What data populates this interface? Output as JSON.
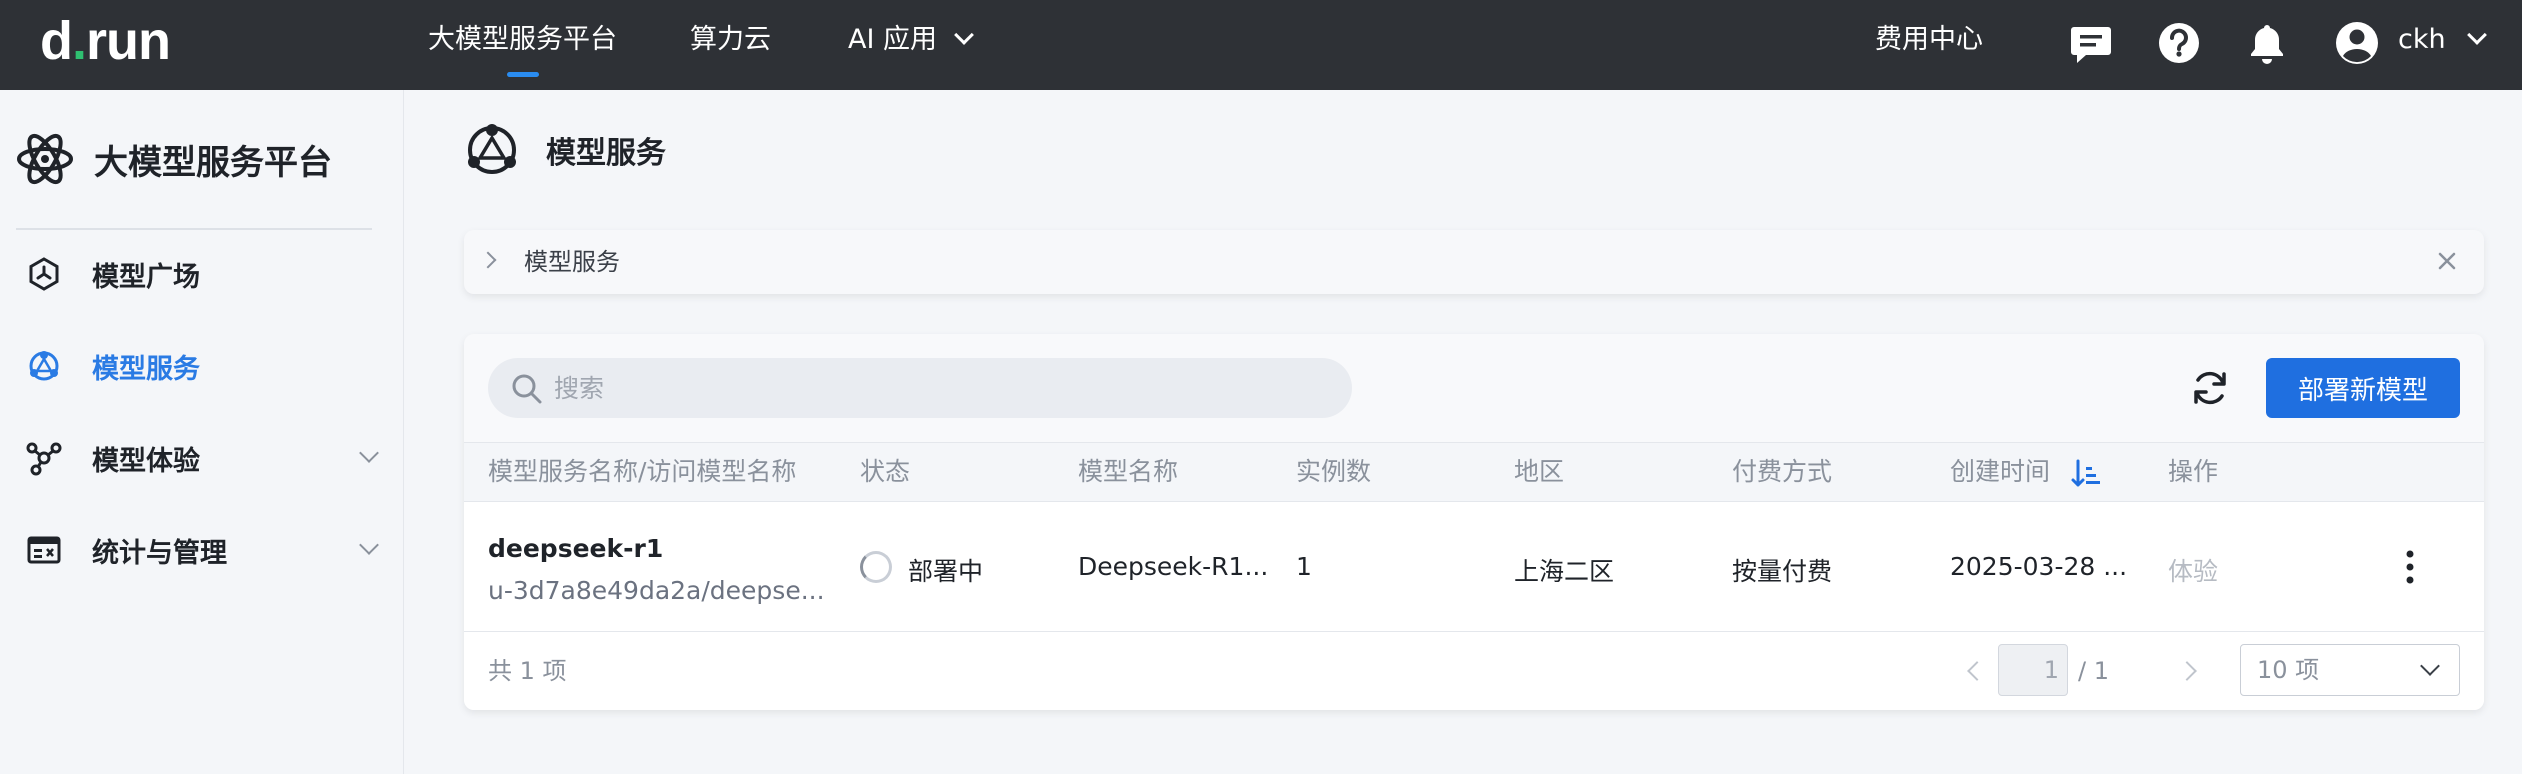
{
  "topbar": {
    "logo_prefix": "d",
    "logo_dot": ".",
    "logo_suffix": "run",
    "nav": [
      {
        "label": "大模型服务平台",
        "active": true
      },
      {
        "label": "算力云",
        "active": false
      },
      {
        "label": "AI 应用",
        "active": false
      }
    ],
    "billing": "费用中心",
    "icons": [
      "message-icon",
      "help-icon",
      "bell-icon",
      "user-avatar-icon"
    ],
    "user": "ckh"
  },
  "sidebar": {
    "title": "大模型服务平台",
    "items": [
      {
        "label": "模型广场",
        "icon": "hexagon-icon",
        "expandable": false,
        "active": false
      },
      {
        "label": "模型服务",
        "icon": "model-service-icon",
        "expandable": false,
        "active": true
      },
      {
        "label": "模型体验",
        "icon": "experience-icon",
        "expandable": true,
        "active": false
      },
      {
        "label": "统计与管理",
        "icon": "stats-icon",
        "expandable": true,
        "active": false
      }
    ]
  },
  "page": {
    "title": "模型服务",
    "breadcrumb": "模型服务"
  },
  "toolbar": {
    "search_placeholder": "搜索",
    "deploy_button": "部署新模型"
  },
  "table": {
    "columns": [
      "模型服务名称/访问模型名称",
      "状态",
      "模型名称",
      "实例数",
      "地区",
      "付费方式",
      "创建时间",
      "操作"
    ],
    "rows": [
      {
        "name": "deepseek-r1",
        "access_name": "u-3d7a8e49da2a/deepse...",
        "status": "部署中",
        "model": "Deepseek-R1...",
        "instances": "1",
        "region": "上海二区",
        "billing": "按量付费",
        "created": "2025-03-28 ...",
        "action": "体验"
      }
    ]
  },
  "pagination": {
    "total": "共 1 项",
    "current": "1",
    "pages": "/ 1",
    "page_size": "10 项"
  },
  "colors": {
    "topbar": "#2e3136",
    "accent": "#1f6fe0",
    "active_text": "#2a7be4",
    "logo_dot": "#2fbf71"
  }
}
